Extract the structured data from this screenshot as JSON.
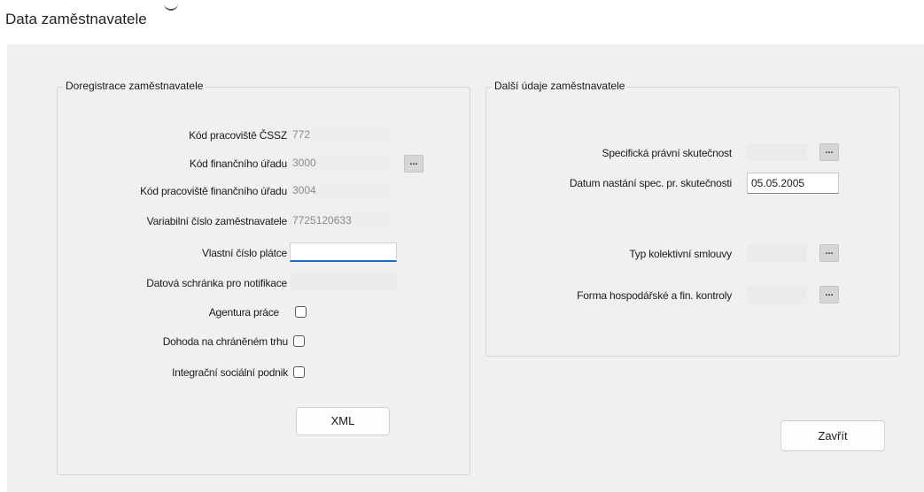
{
  "window": {
    "title": "Data zaměstnavatele"
  },
  "left_group": {
    "title": "Doregistrace zaměstnavatele",
    "fields": {
      "kod_cssz": {
        "label": "Kód pracoviště ČSSZ",
        "value": "772"
      },
      "kod_fu": {
        "label": "Kód finančního úřadu",
        "value": "3000"
      },
      "kod_pracoviste_fu": {
        "label": "Kód pracoviště finančního úřadu",
        "value": "3004"
      },
      "variabilni_cislo": {
        "label": "Variabilní číslo zaměstnavatele",
        "value": "7725120633"
      },
      "vlastni_cislo": {
        "label": "Vlastní číslo plátce",
        "value": ""
      },
      "datova_schranka": {
        "label": "Datová schránka pro notifikace",
        "value": ""
      }
    },
    "checkboxes": {
      "agentura": {
        "label": "Agentura práce",
        "checked": false
      },
      "dohoda": {
        "label": "Dohoda na chráněném trhu",
        "checked": false
      },
      "integracni": {
        "label": "Integrační sociální podnik",
        "checked": false
      }
    },
    "xml_button": "XML",
    "ellipsis": "..."
  },
  "right_group": {
    "title": "Další údaje zaměstnavatele",
    "fields": {
      "specificka": {
        "label": "Specifická právní skutečnost",
        "value": ""
      },
      "datum": {
        "label": "Datum nastání spec. pr. skutečnosti",
        "value": "05.05.2005"
      },
      "typ_kolektivni": {
        "label": "Typ kolektivní smlouvy",
        "value": ""
      },
      "forma_kontroly": {
        "label": "Forma hospodářské a fin. kontroly",
        "value": ""
      }
    },
    "ellipsis": "..."
  },
  "close_button": "Zavřít"
}
